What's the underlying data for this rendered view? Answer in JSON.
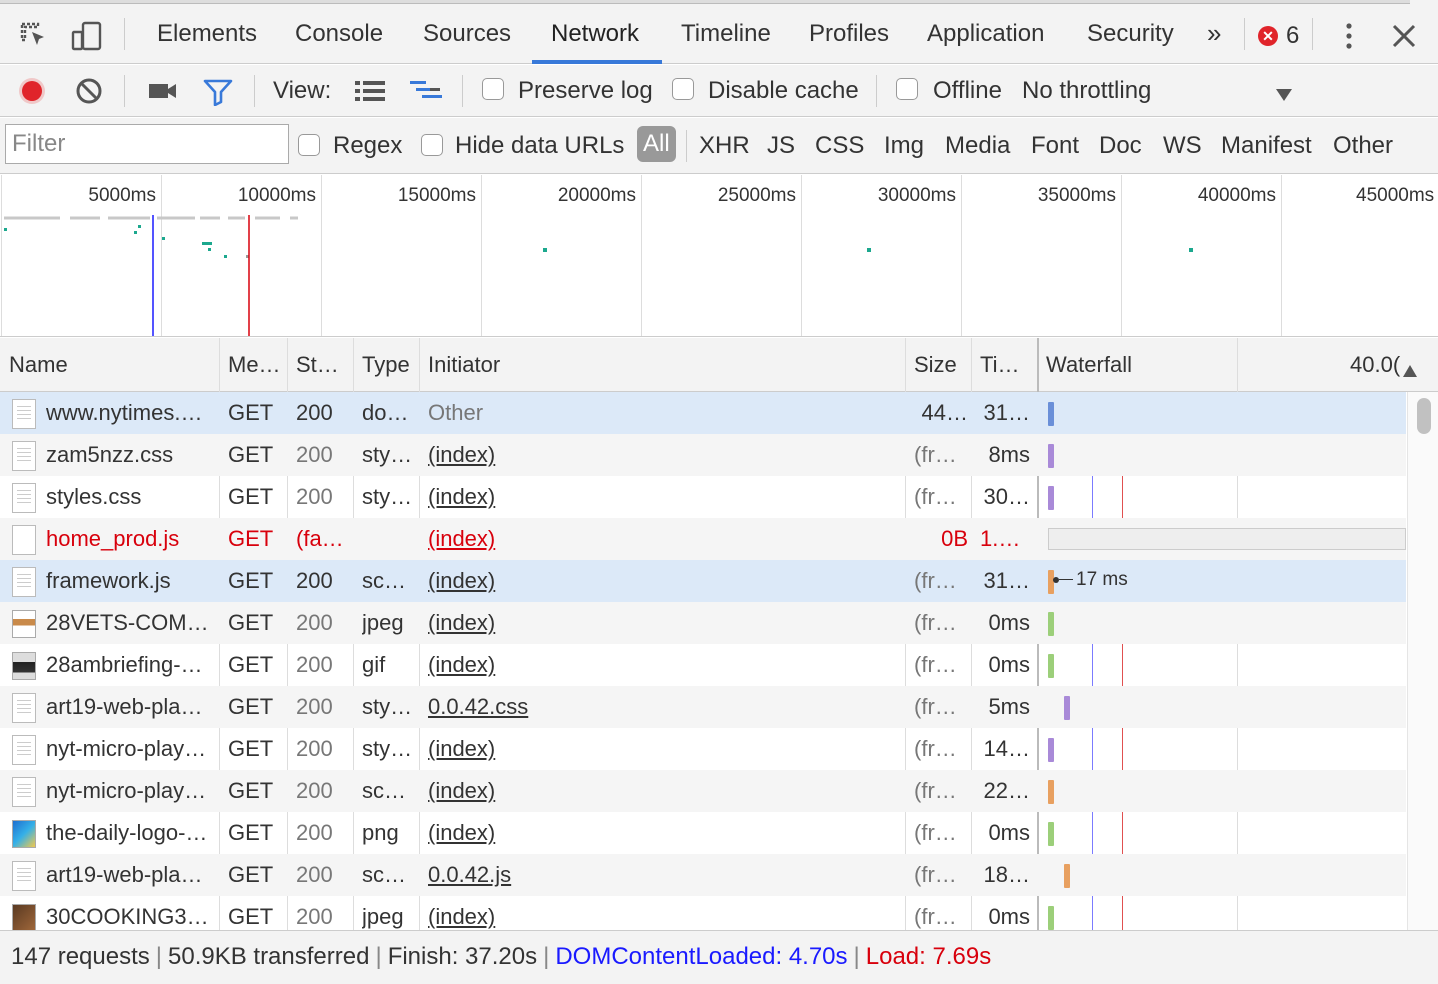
{
  "tabs": [
    {
      "label": "Elements"
    },
    {
      "label": "Console"
    },
    {
      "label": "Sources"
    },
    {
      "label": "Network"
    },
    {
      "label": "Timeline"
    },
    {
      "label": "Profiles"
    },
    {
      "label": "Application"
    },
    {
      "label": "Security"
    }
  ],
  "tabs_more": "»",
  "error_count": "6",
  "active_tab": "Network",
  "toolbar": {
    "view_label": "View:",
    "preserve_log": "Preserve log",
    "disable_cache": "Disable cache",
    "offline": "Offline",
    "throttling": "No throttling"
  },
  "filter": {
    "placeholder": "Filter",
    "regex": "Regex",
    "hide_data_urls": "Hide data URLs",
    "types": [
      "All",
      "XHR",
      "JS",
      "CSS",
      "Img",
      "Media",
      "Font",
      "Doc",
      "WS",
      "Manifest",
      "Other"
    ]
  },
  "overview_ticks": [
    "5000ms",
    "10000ms",
    "15000ms",
    "20000ms",
    "25000ms",
    "30000ms",
    "35000ms",
    "40000ms",
    "45000ms"
  ],
  "columns": {
    "name": "Name",
    "method": "Me…",
    "status": "St…",
    "type": "Type",
    "initiator": "Initiator",
    "size": "Size",
    "time": "Ti…",
    "waterfall": "Waterfall",
    "waterfall_end": "40.0("
  },
  "rows": [
    {
      "name": "www.nytimes.…",
      "method": "GET",
      "status": "200",
      "type": "do…",
      "initiator": "Other",
      "size": "44…",
      "time": "31…"
    },
    {
      "name": "zam5nzz.css",
      "method": "GET",
      "status": "200",
      "type": "sty…",
      "initiator": "(index)",
      "size": "(fro…",
      "time": "8ms"
    },
    {
      "name": "styles.css",
      "method": "GET",
      "status": "200",
      "type": "sty…",
      "initiator": "(index)",
      "size": "(fro…",
      "time": "30…"
    },
    {
      "name": "home_prod.js",
      "method": "GET",
      "status": "(fa…",
      "type": "",
      "initiator": "(index)",
      "size": "0B",
      "time": "1.6…"
    },
    {
      "name": "framework.js",
      "method": "GET",
      "status": "200",
      "type": "sc…",
      "initiator": "(index)",
      "size": "(fro…",
      "time": "31…"
    },
    {
      "name": "28VETS-COM…",
      "method": "GET",
      "status": "200",
      "type": "jpeg",
      "initiator": "(index)",
      "size": "(fro…",
      "time": "0ms"
    },
    {
      "name": "28ambriefing-…",
      "method": "GET",
      "status": "200",
      "type": "gif",
      "initiator": "(index)",
      "size": "(fro…",
      "time": "0ms"
    },
    {
      "name": "art19-web-pla…",
      "method": "GET",
      "status": "200",
      "type": "sty…",
      "initiator": "0.0.42.css",
      "size": "(fro…",
      "time": "5ms"
    },
    {
      "name": "nyt-micro-play…",
      "method": "GET",
      "status": "200",
      "type": "sty…",
      "initiator": "(index)",
      "size": "(fro…",
      "time": "14…"
    },
    {
      "name": "nyt-micro-play…",
      "method": "GET",
      "status": "200",
      "type": "sc…",
      "initiator": "(index)",
      "size": "(fro…",
      "time": "22…"
    },
    {
      "name": "the-daily-logo-…",
      "method": "GET",
      "status": "200",
      "type": "png",
      "initiator": "(index)",
      "size": "(fro…",
      "time": "0ms"
    },
    {
      "name": "art19-web-pla…",
      "method": "GET",
      "status": "200",
      "type": "sc…",
      "initiator": "0.0.42.js",
      "size": "(fro…",
      "time": "18…"
    },
    {
      "name": "30COOKING3…",
      "method": "GET",
      "status": "200",
      "type": "jpeg",
      "initiator": "(index)",
      "size": "(fro…",
      "time": "0ms"
    }
  ],
  "waterfall_tooltip": "17 ms",
  "status": {
    "requests": "147 requests",
    "transferred": "50.9KB transferred",
    "finish": "Finish: 37.20s",
    "dcl": "DOMContentLoaded: 4.70s",
    "load": "Load: 7.69s"
  },
  "colors": {
    "accent": "#3879d9",
    "error": "#d8000c",
    "dcl_line": "#1a1aff",
    "load_line": "#d8000c",
    "record": "#e0242a"
  }
}
